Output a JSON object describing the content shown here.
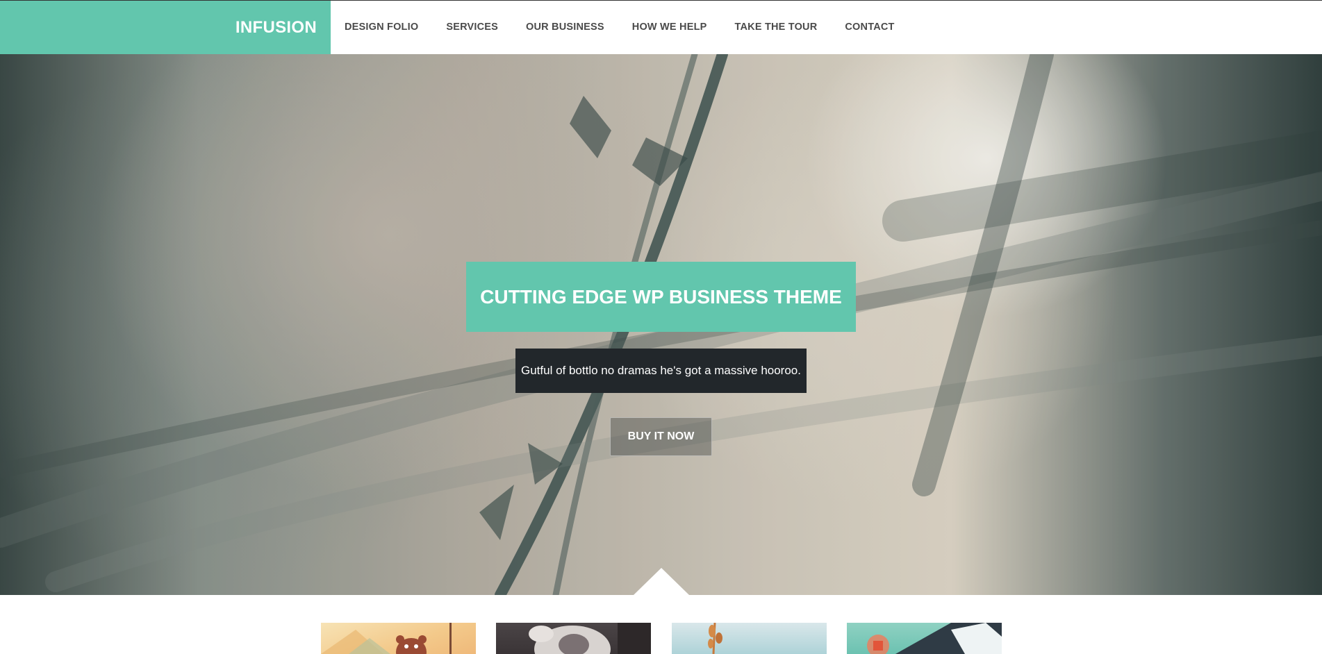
{
  "header": {
    "brand": "INFUSION",
    "nav": [
      "DESIGN FOLIO",
      "SERVICES",
      "OUR BUSINESS",
      "HOW WE HELP",
      "TAKE THE TOUR",
      "CONTACT"
    ]
  },
  "hero": {
    "title": "CUTTING EDGE WP BUSINESS THEME",
    "subtitle": "Gutful of bottlo no dramas he's got a massive hooroo.",
    "button": "BUY IT NOW"
  },
  "colors": {
    "accent": "#62c6ad",
    "dark_panel": "#22272b"
  }
}
